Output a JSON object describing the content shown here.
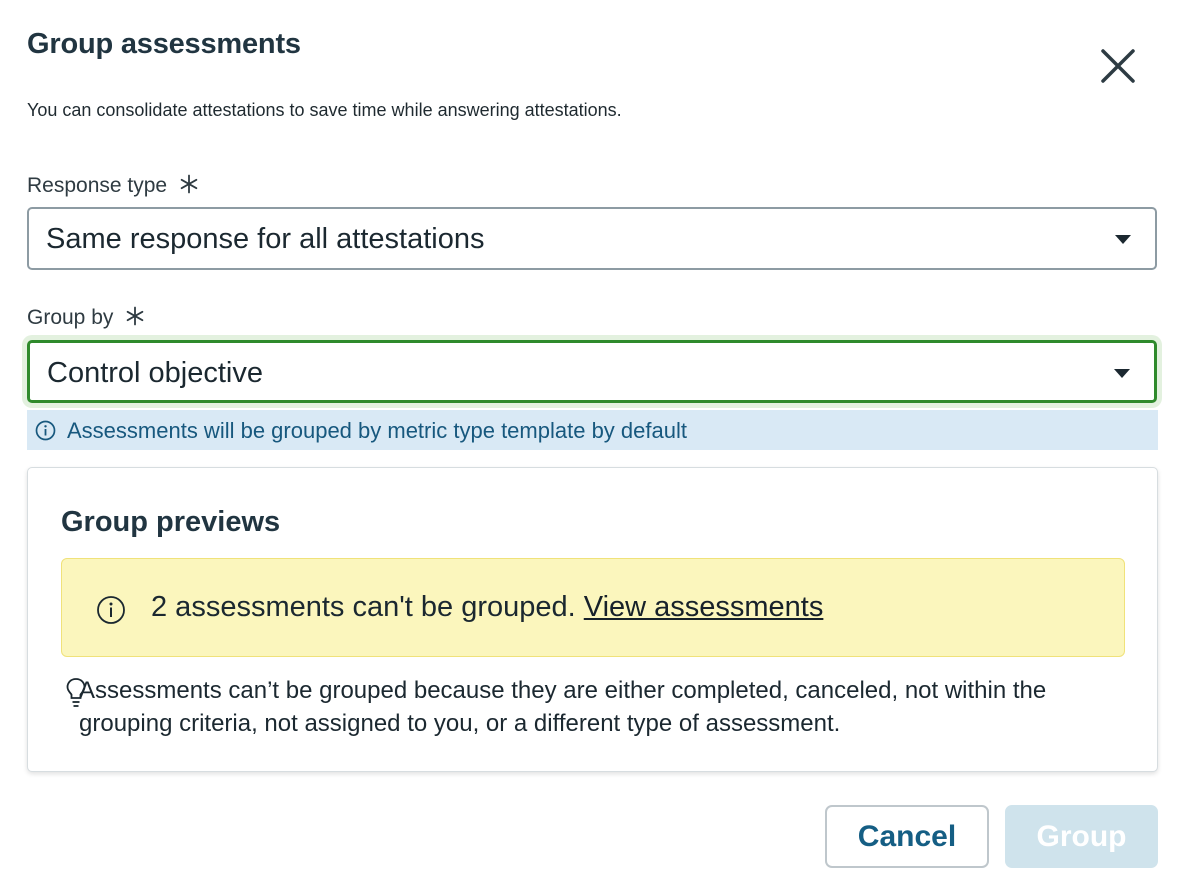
{
  "dialog": {
    "title": "Group assessments",
    "subtitle": "You can consolidate attestations to save time while answering attestations.",
    "close_icon": "close-icon"
  },
  "response_type": {
    "label": "Response type",
    "required_icon": "asterisk-icon",
    "value": "Same response for all attestations"
  },
  "group_by": {
    "label": "Group by",
    "required_icon": "asterisk-icon",
    "value": "Control objective",
    "info_icon": "info-icon",
    "info_text": "Assessments will be grouped by metric type template by default"
  },
  "preview": {
    "title": "Group previews",
    "warning_icon": "info-icon",
    "warning_text": "2 assessments can't be grouped.",
    "warning_link": "View assessments",
    "hint_icon": "lightbulb-icon",
    "hint_text": "Assessments can’t be grouped because they are either completed, canceled, not within the grouping criteria, not assigned to you, or a different type of assessment."
  },
  "actions": {
    "cancel_label": "Cancel",
    "group_label": "Group"
  },
  "colors": {
    "focus_border": "#2f8a2c",
    "info_bg": "#d9e9f5",
    "warning_bg": "#fbf6bd",
    "primary_text": "#155e84",
    "disabled_bg": "#cfe3ec"
  }
}
